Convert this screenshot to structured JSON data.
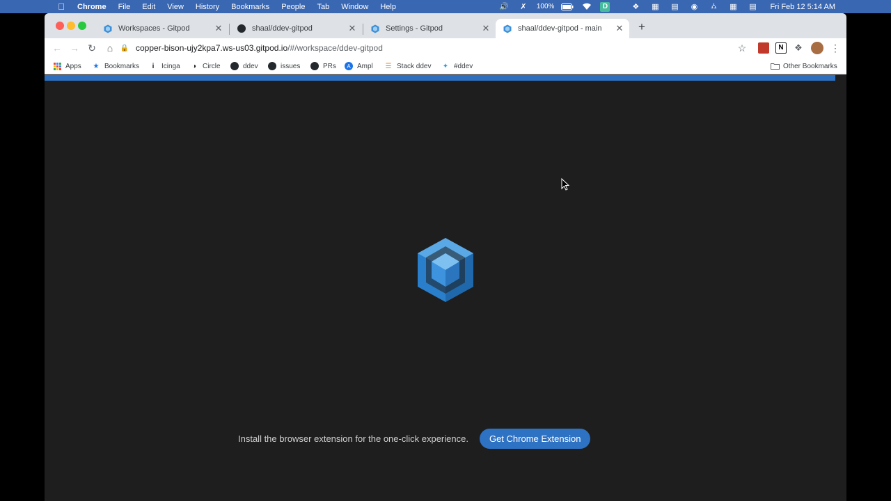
{
  "menubar": {
    "app_name": "Chrome",
    "items": [
      "File",
      "Edit",
      "View",
      "History",
      "Bookmarks",
      "People",
      "Tab",
      "Window",
      "Help"
    ],
    "battery": "100%",
    "clock": "Fri Feb 12  5:14 AM"
  },
  "tabs": [
    {
      "title": "Workspaces - Gitpod",
      "icon": "gitpod-icon"
    },
    {
      "title": "shaal/ddev-gitpod",
      "icon": "github-icon"
    },
    {
      "title": "Settings - Gitpod",
      "icon": "gitpod-icon"
    },
    {
      "title": "shaal/ddev-gitpod - main",
      "icon": "gitpod-icon",
      "active": true
    }
  ],
  "address": {
    "host": "copper-bison-ujy2kpa7.ws-us03.gitpod.io",
    "path": "/#/workspace/ddev-gitpod"
  },
  "bookmarks": [
    {
      "label": "Apps",
      "icon": "apps-grid-icon"
    },
    {
      "label": "Bookmarks",
      "icon": "star-icon"
    },
    {
      "label": "Icinga",
      "icon": "icinga-icon"
    },
    {
      "label": "Circle",
      "icon": "circleci-icon"
    },
    {
      "label": "ddev",
      "icon": "github-icon"
    },
    {
      "label": "issues",
      "icon": "github-icon"
    },
    {
      "label": "PRs",
      "icon": "github-icon"
    },
    {
      "label": "Ampl",
      "icon": "amplitude-icon"
    },
    {
      "label": "Stack ddev",
      "icon": "stackoverflow-icon"
    },
    {
      "label": "#ddev",
      "icon": "twitter-icon"
    }
  ],
  "other_bookmarks": "Other Bookmarks",
  "main": {
    "install_text": "Install the browser extension for the one-click experience.",
    "button_label": "Get Chrome Extension"
  },
  "colors": {
    "menubar": "#3a67b2",
    "accent": "#2e72c4",
    "background": "#1e1e1e"
  }
}
